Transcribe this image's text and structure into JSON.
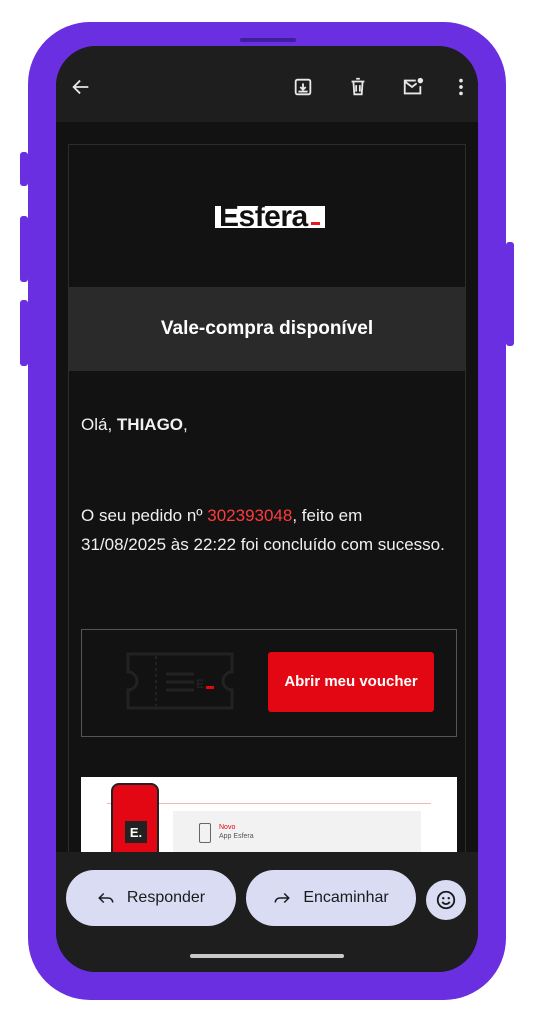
{
  "toolbar": {
    "back_icon": "arrow-left-icon",
    "archive_icon": "archive-icon",
    "delete_icon": "trash-icon",
    "mark_unread_icon": "mail-unread-icon",
    "more_icon": "more-vertical-icon"
  },
  "email": {
    "logo_text": "Esfera",
    "banner_title": "Vale-compra disponível",
    "greeting_prefix": "Olá, ",
    "greeting_name": "THIAGO",
    "greeting_suffix": ",",
    "message_prefix": "O seu pedido nº ",
    "order_number": "302393048",
    "message_suffix": ", feito em 31/08/2025 às 22:22 foi concluído com sucesso.",
    "voucher_button_label": "Abrir meu voucher",
    "promo_line1": "Novo",
    "promo_line2": "App Esfera",
    "promo_badge": "E."
  },
  "actions": {
    "reply_label": "Responder",
    "forward_label": "Encaminhar",
    "emoji_icon": "smiley-icon"
  },
  "colors": {
    "frame": "#6a2fe0",
    "accent_red": "#e30613",
    "order_red": "#ff3b3b",
    "pill_bg": "#d9dcf2"
  }
}
